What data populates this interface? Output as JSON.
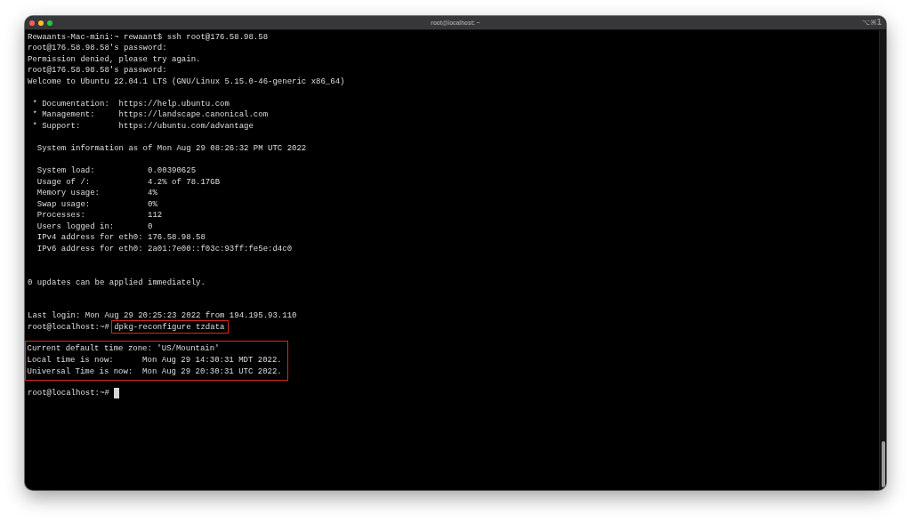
{
  "window": {
    "title": "root@localhost: ~",
    "shortcut": "⌥⌘1"
  },
  "terminal": {
    "lines": [
      {
        "kind": "prompt",
        "prompt": "Rewaants-Mac-mini:~ rewaant$",
        "command": "ssh root@176.58.98.58",
        "highlighted": false,
        "cursor": false
      },
      {
        "kind": "output",
        "text": "root@176.58.98.58's password:"
      },
      {
        "kind": "output",
        "text": "Permission denied, please try again."
      },
      {
        "kind": "output",
        "text": "root@176.58.98.58's password:"
      },
      {
        "kind": "output",
        "text": "Welcome to Ubuntu 22.04.1 LTS (GNU/Linux 5.15.0-46-generic x86_64)"
      },
      {
        "kind": "blank"
      },
      {
        "kind": "output",
        "text": " * Documentation:  https://help.ubuntu.com"
      },
      {
        "kind": "output",
        "text": " * Management:     https://landscape.canonical.com"
      },
      {
        "kind": "output",
        "text": " * Support:        https://ubuntu.com/advantage"
      },
      {
        "kind": "blank"
      },
      {
        "kind": "output",
        "text": "  System information as of Mon Aug 29 08:26:32 PM UTC 2022"
      },
      {
        "kind": "blank"
      },
      {
        "kind": "output",
        "text": "  System load:           0.00390625"
      },
      {
        "kind": "output",
        "text": "  Usage of /:            4.2% of 78.17GB"
      },
      {
        "kind": "output",
        "text": "  Memory usage:          4%"
      },
      {
        "kind": "output",
        "text": "  Swap usage:            0%"
      },
      {
        "kind": "output",
        "text": "  Processes:             112"
      },
      {
        "kind": "output",
        "text": "  Users logged in:       0"
      },
      {
        "kind": "output",
        "text": "  IPv4 address for eth0: 176.58.98.58"
      },
      {
        "kind": "output",
        "text": "  IPv6 address for eth0: 2a01:7e00::f03c:93ff:fe5e:d4c0"
      },
      {
        "kind": "blank"
      },
      {
        "kind": "blank"
      },
      {
        "kind": "output",
        "text": "0 updates can be applied immediately."
      },
      {
        "kind": "blank"
      },
      {
        "kind": "blank"
      },
      {
        "kind": "output",
        "text": "Last login: Mon Aug 29 20:25:23 2022 from 194.195.93.110"
      },
      {
        "kind": "prompt",
        "prompt": "root@localhost:~#",
        "command": "dpkg-reconfigure tzdata",
        "highlighted": true,
        "cursor": false
      },
      {
        "kind": "blank"
      },
      {
        "kind": "group",
        "highlighted": true,
        "lines": [
          "Current default time zone: 'US/Mountain'",
          "Local time is now:      Mon Aug 29 14:30:31 MDT 2022.",
          "Universal Time is now:  Mon Aug 29 20:30:31 UTC 2022."
        ]
      },
      {
        "kind": "blank"
      },
      {
        "kind": "prompt",
        "prompt": "root@localhost:~#",
        "cursor": true
      }
    ]
  }
}
